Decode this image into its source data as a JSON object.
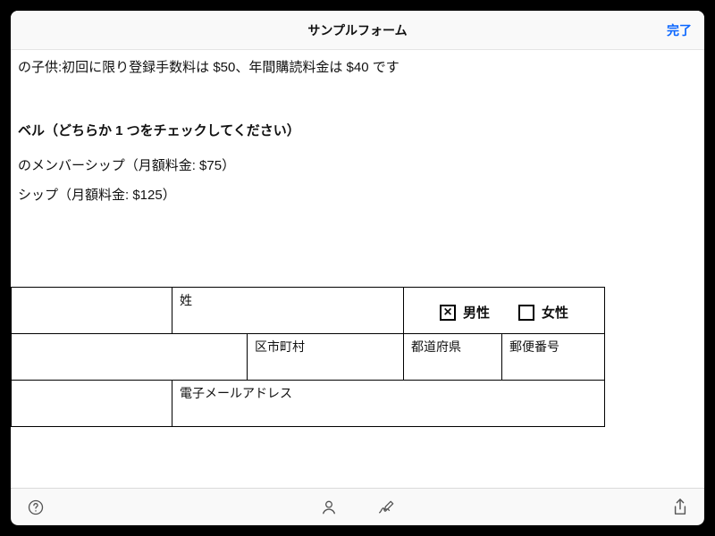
{
  "header": {
    "title": "サンプルフォーム",
    "done_label": "完了"
  },
  "body": {
    "child_line": "の子供:初回に限り登録手数料は $50、年間購読料金は $40 です",
    "level_heading": "ベル（どちらか 1 つをチェックしてください）",
    "option_1": "のメンバーシップ（月額料金: $75）",
    "option_2": "シップ（月額料金: $125）"
  },
  "table": {
    "last_name_label": "姓",
    "gender_male": "男性",
    "gender_female": "女性",
    "gender_male_checked": "×",
    "city_label": "区市町村",
    "prefecture_label": "都道府県",
    "postal_label": "郵便番号",
    "email_label": "電子メールアドレス"
  },
  "icons": {
    "help": "help-icon",
    "person": "person-icon",
    "sign": "sign-icon",
    "share": "share-icon"
  }
}
